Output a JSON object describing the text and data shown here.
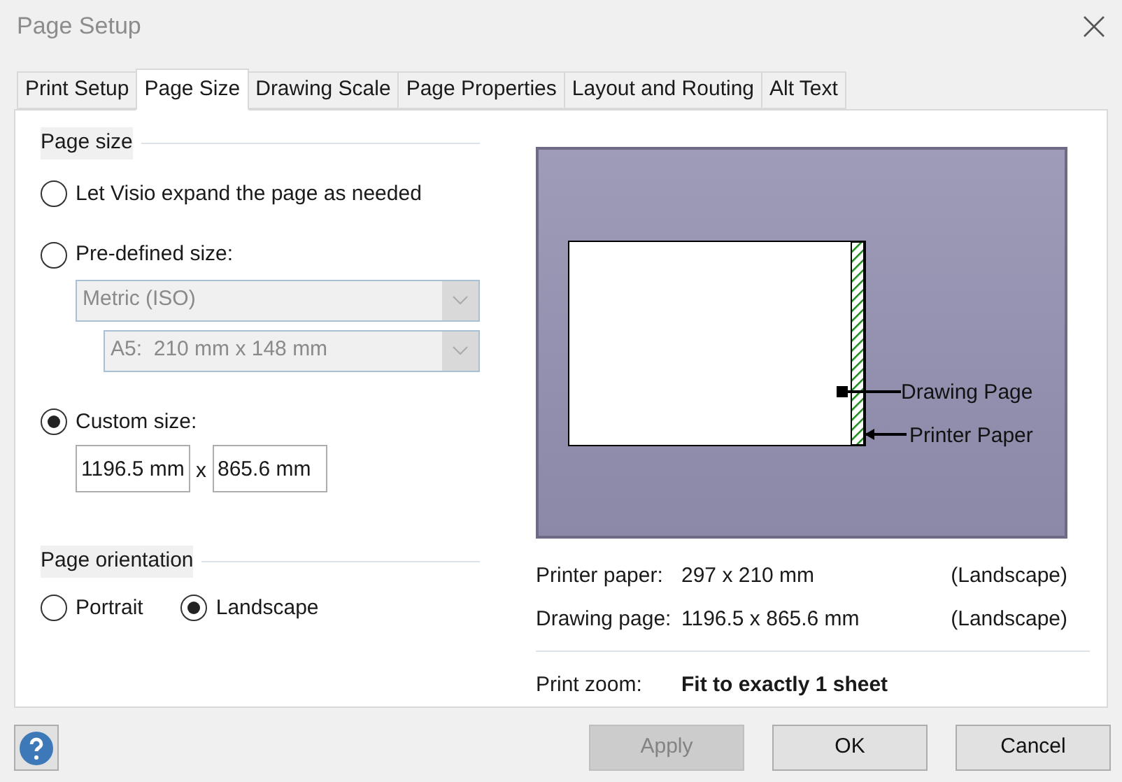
{
  "window": {
    "title": "Page Setup"
  },
  "tabs": [
    {
      "label": "Print Setup",
      "selected": false
    },
    {
      "label": "Page Size",
      "selected": true
    },
    {
      "label": "Drawing Scale",
      "selected": false
    },
    {
      "label": "Page Properties",
      "selected": false
    },
    {
      "label": "Layout and Routing",
      "selected": false
    },
    {
      "label": "Alt Text",
      "selected": false
    }
  ],
  "page_size": {
    "heading": "Page size",
    "options": [
      {
        "kind": "plain",
        "label": "Let Visio expand the page as needed",
        "selected": false
      },
      {
        "kind": "predefined",
        "label": "Pre-defined size:",
        "selected": false,
        "dropdowns": [
          {
            "value": "Metric (ISO)",
            "disabled": true
          },
          {
            "value": "A5:  210 mm x 148 mm",
            "disabled": true
          }
        ]
      },
      {
        "kind": "custom",
        "label": "Custom size:",
        "selected": true,
        "width": "1196.5 mm",
        "separator": "x",
        "height": "865.6 mm"
      }
    ]
  },
  "page_orientation": {
    "heading": "Page orientation",
    "options": [
      {
        "label": "Portrait",
        "selected": false
      },
      {
        "label": "Landscape",
        "selected": true
      }
    ]
  },
  "preview": {
    "drawing_page_label": "Drawing Page",
    "printer_paper_label": "Printer Paper"
  },
  "info": {
    "rows": [
      {
        "label": "Printer paper:",
        "value": "297 x 210 mm",
        "orientation": "(Landscape)"
      },
      {
        "label": "Drawing page:",
        "value": "1196.5 x 865.6 mm",
        "orientation": "(Landscape)"
      }
    ],
    "print_zoom": {
      "label": "Print zoom:",
      "value": "Fit to exactly 1 sheet"
    }
  },
  "buttons": [
    {
      "label": "Apply",
      "disabled": true
    },
    {
      "label": "OK",
      "disabled": false
    },
    {
      "label": "Cancel",
      "disabled": false
    }
  ]
}
